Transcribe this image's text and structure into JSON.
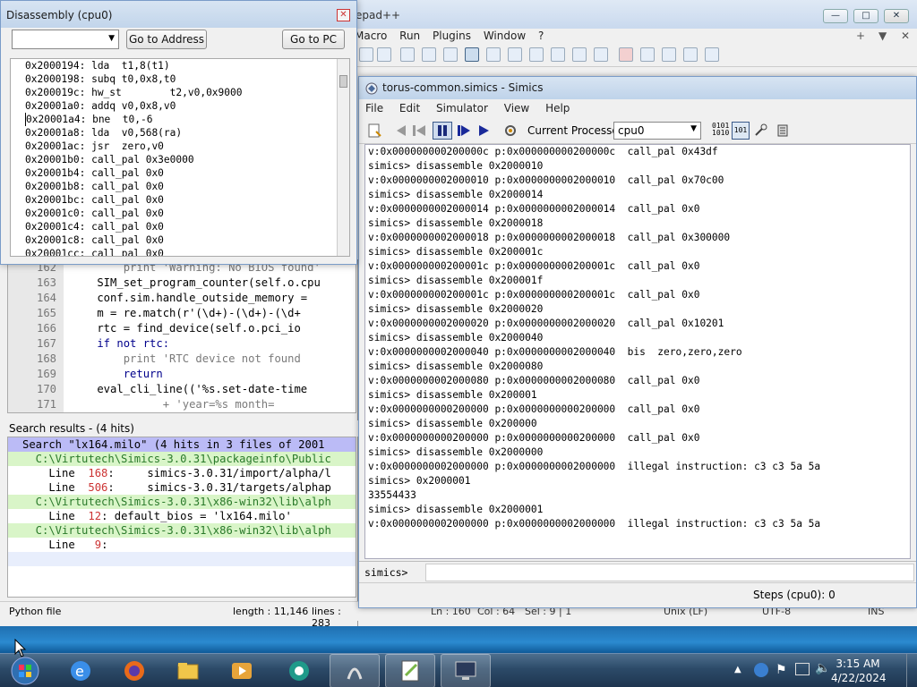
{
  "notepad": {
    "title_fragment": "epad++",
    "menu": [
      "Macro",
      "Run",
      "Plugins",
      "Window",
      "?"
    ],
    "menu_extra": [
      "+",
      "▼",
      "✕"
    ],
    "window_buttons": [
      "—",
      "□",
      "✕"
    ],
    "status": {
      "type": "Python file",
      "length": "length : 11,146",
      "lines": "lines : 283",
      "ln": "Ln : 160",
      "col": "Col : 64",
      "sel": "Sel : 9 | 1",
      "eol": "Unix (LF)",
      "enc": "UTF-8",
      "mode": "INS"
    }
  },
  "editor": {
    "lines": [
      {
        "num": "162",
        "code": "        print 'Warning: No BIOS found'"
      },
      {
        "num": "163",
        "code": "    SIM_set_program_counter(self.o.cpu"
      },
      {
        "num": "164",
        "code": "    conf.sim.handle_outside_memory ="
      },
      {
        "num": "165",
        "code": "    m = re.match(r'(\\d+)-(\\d+)-(\\d+"
      },
      {
        "num": "166",
        "code": "    rtc = find_device(self.o.pci_io"
      },
      {
        "num": "167",
        "code": "    if not rtc:"
      },
      {
        "num": "168",
        "code": "        print 'RTC device not found"
      },
      {
        "num": "169",
        "code": "        return"
      },
      {
        "num": "170",
        "code": "    eval_cli_line(('%s.set-date-time"
      },
      {
        "num": "171",
        "code": "              + 'year=%s month="
      }
    ]
  },
  "search": {
    "header": "Search results - (4 hits)",
    "lines": [
      {
        "kind": "search",
        "text": "Search \"lx164.milo\" (4 hits in 3 files of 2001"
      },
      {
        "kind": "file",
        "text": "  C:\\Virtutech\\Simics-3.0.31\\packageinfo\\Public"
      },
      {
        "kind": "hit",
        "prefix": "    Line  ",
        "num": "168",
        "text": ":     simics-3.0.31/import/alpha/l"
      },
      {
        "kind": "hit",
        "prefix": "    Line  ",
        "num": "506",
        "text": ":     simics-3.0.31/targets/alphap"
      },
      {
        "kind": "file",
        "text": "  C:\\Virtutech\\Simics-3.0.31\\x86-win32\\lib\\alph"
      },
      {
        "kind": "hit",
        "prefix": "    Line  ",
        "num": "12",
        "text": ": default_bios = 'lx164.milo'"
      },
      {
        "kind": "file",
        "text": "  C:\\Virtutech\\Simics-3.0.31\\x86-win32\\lib\\alph"
      },
      {
        "kind": "hit",
        "prefix": "    Line   ",
        "num": "9",
        "text": ":"
      }
    ]
  },
  "disasm": {
    "title": "Disassembly (cpu0)",
    "address_placeholder": "",
    "goto_address": "Go to Address",
    "goto_pc": "Go to PC",
    "lines": [
      "0x2000194: lda  t1,8(t1)",
      "0x2000198: subq t0,0x8,t0",
      "0x200019c: hw_st        t2,v0,0x9000",
      "0x20001a0: addq v0,0x8,v0",
      "0x20001a4: bne  t0,-6",
      "0x20001a8: lda  v0,568(ra)",
      "0x20001ac: jsr  zero,v0",
      "0x20001b0: call_pal 0x3e0000",
      "0x20001b4: call_pal 0x0",
      "0x20001b8: call_pal 0x0",
      "0x20001bc: call_pal 0x0",
      "0x20001c0: call_pal 0x0",
      "0x20001c4: call_pal 0x0",
      "0x20001c8: call_pal 0x0",
      "0x20001cc: call_pal 0x0"
    ]
  },
  "simics": {
    "title": "torus-common.simics - Simics",
    "menu": [
      "File",
      "Edit",
      "Simulator",
      "View",
      "Help"
    ],
    "processor_label": "Current Processor:",
    "processor_value": "cpu0",
    "prompt": "simics>",
    "steps": "Steps (cpu0): 0",
    "console": [
      "v:0x000000000200000c p:0x000000000200000c  call_pal 0x43df",
      "simics> disassemble 0x2000010",
      "v:0x0000000002000010 p:0x0000000002000010  call_pal 0x70c00",
      "simics> disassemble 0x2000014",
      "v:0x0000000002000014 p:0x0000000002000014  call_pal 0x0",
      "simics> disassemble 0x2000018",
      "v:0x0000000002000018 p:0x0000000002000018  call_pal 0x300000",
      "simics> disassemble 0x200001c",
      "v:0x000000000200001c p:0x000000000200001c  call_pal 0x0",
      "simics> disassemble 0x200001f",
      "v:0x000000000200001c p:0x000000000200001c  call_pal 0x0",
      "simics> disassemble 0x2000020",
      "v:0x0000000002000020 p:0x0000000002000020  call_pal 0x10201",
      "simics> disassemble 0x2000040",
      "v:0x0000000002000040 p:0x0000000002000040  bis  zero,zero,zero",
      "simics> disassemble 0x2000080",
      "v:0x0000000002000080 p:0x0000000002000080  call_pal 0x0",
      "simics> disassemble 0x200001",
      "v:0x0000000000200000 p:0x0000000000200000  call_pal 0x0",
      "simics> disassemble 0x200000",
      "v:0x0000000000200000 p:0x0000000000200000  call_pal 0x0",
      "simics> disassemble 0x2000000",
      "v:0x0000000002000000 p:0x0000000002000000  illegal instruction: c3 c3 5a 5a",
      "simics> 0x2000001",
      "33554433",
      "simics> disassemble 0x2000001",
      "v:0x0000000002000000 p:0x0000000002000000  illegal instruction: c3 c3 5a 5a"
    ]
  },
  "taskbar": {
    "time": "3:15 AM",
    "date": "4/22/2024"
  },
  "colors": {
    "accent": "#bbbbf6",
    "file_hit": "#d9f5c8",
    "line_num": "#e8e8e8"
  }
}
